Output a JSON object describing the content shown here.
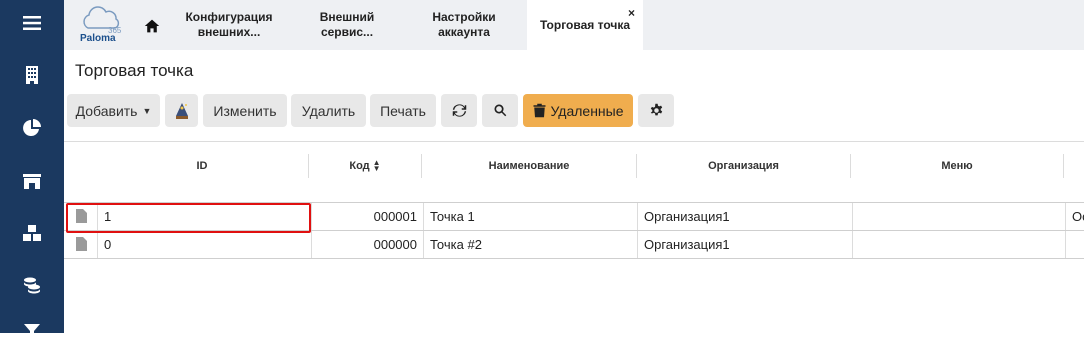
{
  "sidebar": {
    "icons": [
      "menu-icon",
      "building-icon",
      "pie-chart-icon",
      "store-icon",
      "boxes-icon",
      "coins-icon",
      "filter-icon"
    ]
  },
  "logo": {
    "text": "Paloma",
    "number": "365"
  },
  "tabs": [
    {
      "label": "Конфигурация внешних..."
    },
    {
      "label": "Внешний сервис..."
    },
    {
      "label": "Настройки аккаунта"
    },
    {
      "label": "Торговая точка",
      "close": "×"
    }
  ],
  "page": {
    "title": "Торговая точка"
  },
  "toolbar": {
    "add": "Добавить",
    "edit": "Изменить",
    "delete": "Удалить",
    "print": "Печать",
    "deleted": "Удаленные"
  },
  "table": {
    "columns": [
      "ID",
      "Код",
      "Наименование",
      "Организация",
      "Меню"
    ],
    "rows": [
      {
        "id": "1",
        "code": "000001",
        "name": "Точка 1",
        "org": "Организация1",
        "menu": "",
        "extra": "Ос"
      },
      {
        "id": "0",
        "code": "000000",
        "name": "Точка #2",
        "org": "Организация1",
        "menu": "",
        "extra": ""
      }
    ]
  },
  "colors": {
    "sidebar": "#1b3960",
    "accent": "#f0ad4e",
    "highlight": "#e01010"
  }
}
